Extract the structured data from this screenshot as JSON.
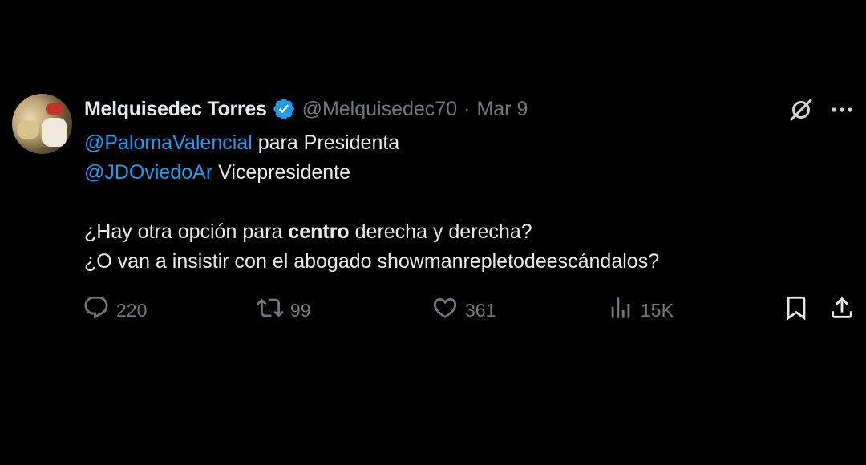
{
  "author": {
    "name": "Melquisedec Torres",
    "handle": "@Melquisedec70",
    "separator": "·",
    "date": "Mar 9",
    "verified": true
  },
  "tweet": {
    "line1_mention": "@PalomaValencial",
    "line1_text": " para Presidenta",
    "line2_mention": "@JDOviedoAr",
    "line2_text": " Vicepresidente",
    "line3_pre": "¿Hay otra opción para ",
    "line3_bold": "centro",
    "line3_post": " derecha y derecha?",
    "line4": "¿O van a insistir con el abogado showmanrepletodeescándalos?"
  },
  "actions": {
    "replies": "220",
    "reposts": "99",
    "likes": "361",
    "views": "15K"
  },
  "icons": {
    "reply": "reply-icon",
    "repost": "repost-icon",
    "like": "heart-icon",
    "views": "views-chart-icon",
    "bookmark": "bookmark-icon",
    "share": "share-icon",
    "grok": "grok-icon",
    "more": "more-icon",
    "verified": "verified-badge-icon"
  },
  "colors": {
    "background": "#000000",
    "text": "#e7e9ea",
    "muted": "#71767b",
    "accent": "#1d9bf0"
  }
}
